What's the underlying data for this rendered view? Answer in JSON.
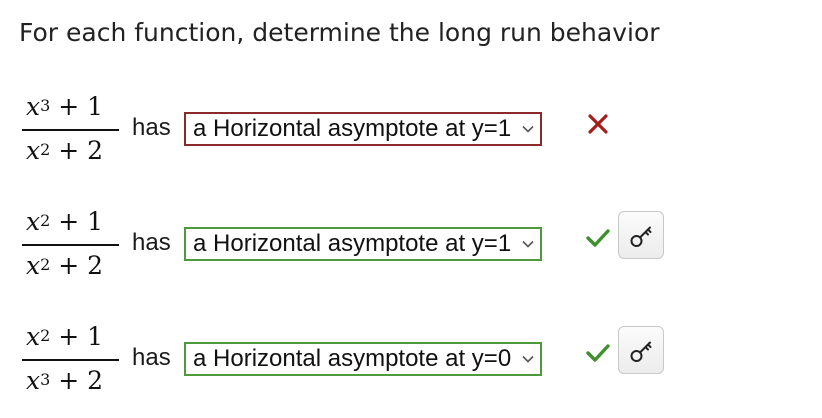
{
  "prompt": "For each function, determine the long run behavior",
  "problems": [
    {
      "numerator": {
        "base": "x",
        "exp": "3",
        "rest": " + 1"
      },
      "denominator": {
        "base": "x",
        "exp": "2",
        "rest": " + 2"
      },
      "connector": "has",
      "selected": "a Horizontal asymptote at y=1",
      "status": "incorrect",
      "status_icon": "cross-icon",
      "status_color": "#a31d1d",
      "has_key_button": false
    },
    {
      "numerator": {
        "base": "x",
        "exp": "2",
        "rest": " + 1"
      },
      "denominator": {
        "base": "x",
        "exp": "2",
        "rest": " + 2"
      },
      "connector": "has",
      "selected": "a Horizontal asymptote at y=1",
      "status": "correct",
      "status_icon": "checkmark-icon",
      "status_color": "#3f8f2e",
      "has_key_button": true,
      "key_icon": "key-icon"
    },
    {
      "numerator": {
        "base": "x",
        "exp": "2",
        "rest": " + 1"
      },
      "denominator": {
        "base": "x",
        "exp": "3",
        "rest": " + 2"
      },
      "connector": "has",
      "selected": "a Horizontal asymptote at y=0",
      "status": "correct",
      "status_icon": "checkmark-icon",
      "status_color": "#3f8f2e",
      "has_key_button": true,
      "key_icon": "key-icon"
    }
  ]
}
